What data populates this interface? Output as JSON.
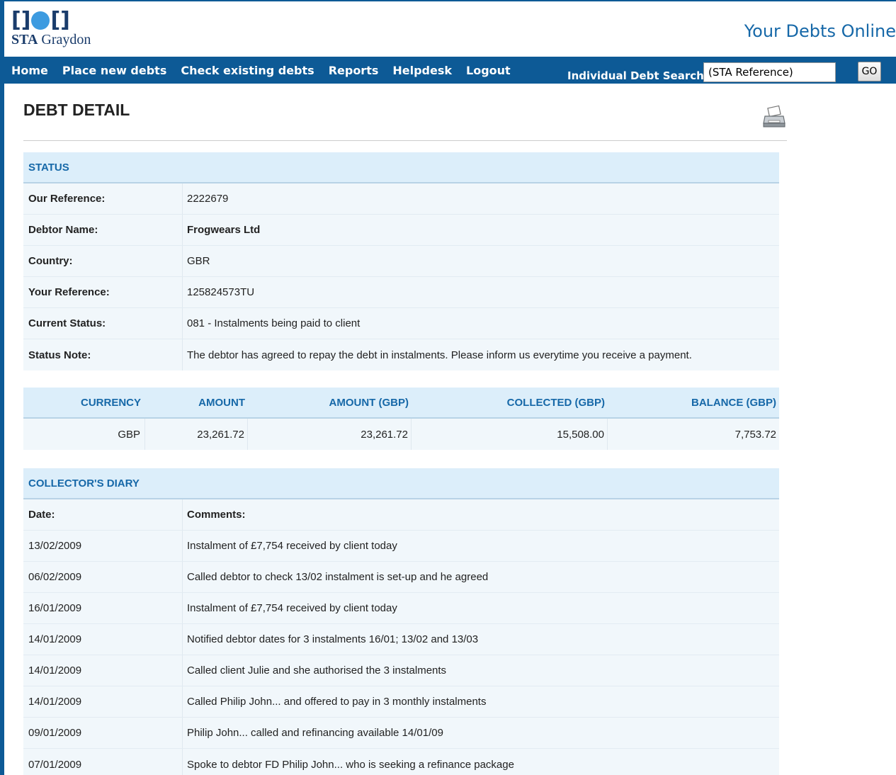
{
  "header": {
    "logo_text_bold": "STA",
    "logo_text": "Graydon",
    "site_title": "Your Debts Online"
  },
  "nav": {
    "items": [
      "Home",
      "Place new debts",
      "Check existing debts",
      "Reports",
      "Helpdesk",
      "Logout"
    ],
    "search_label": "Individual Debt Search",
    "search_value": "(STA Reference)",
    "go_label": "GO"
  },
  "page": {
    "title": "DEBT DETAIL",
    "print_icon": "printer-icon"
  },
  "status": {
    "heading": "STATUS",
    "rows": [
      {
        "label": "Our Reference:",
        "value": "2222679"
      },
      {
        "label": "Debtor Name:",
        "value": "Frogwears Ltd"
      },
      {
        "label": "Country:",
        "value": "GBR"
      },
      {
        "label": "Your Reference:",
        "value": "125824573TU"
      },
      {
        "label": "Current Status:",
        "value": "081 - Instalments being paid to client"
      },
      {
        "label": "Status Note:",
        "value": "The debtor has agreed to repay the debt in instalments. Please inform us everytime you receive a payment."
      }
    ]
  },
  "amounts": {
    "headers": [
      "CURRENCY",
      "AMOUNT",
      "AMOUNT (GBP)",
      "COLLECTED (GBP)",
      "BALANCE (GBP)"
    ],
    "values": [
      "GBP",
      "23,261.72",
      "23,261.72",
      "15,508.00",
      "7,753.72"
    ]
  },
  "diary": {
    "heading": "COLLECTOR'S DIARY",
    "date_header": "Date:",
    "comments_header": "Comments:",
    "entries": [
      {
        "date": "13/02/2009",
        "comment": "Instalment of £7,754 received by client today"
      },
      {
        "date": "06/02/2009",
        "comment": "Called debtor to check 13/02 instalment is set-up and he agreed"
      },
      {
        "date": "16/01/2009",
        "comment": "Instalment of £7,754 received by client today"
      },
      {
        "date": "14/01/2009",
        "comment": "Notified debtor dates for 3 instalments 16/01; 13/02 and 13/03"
      },
      {
        "date": "14/01/2009",
        "comment": "Called client Julie and she authorised the 3 instalments"
      },
      {
        "date": "14/01/2009",
        "comment": "Called Philip John... and offered to pay in 3 monthly instalments"
      },
      {
        "date": "09/01/2009",
        "comment": "Philip John... called and refinancing available 14/01/09"
      },
      {
        "date": "07/01/2009",
        "comment": "Spoke to debtor FD Philip John... who is seeking a refinance package"
      }
    ]
  },
  "colors": {
    "nav_bg": "#0d5a96",
    "accent": "#1668a8",
    "panel_head": "#dceefa",
    "panel_body": "#f1f7fb"
  }
}
